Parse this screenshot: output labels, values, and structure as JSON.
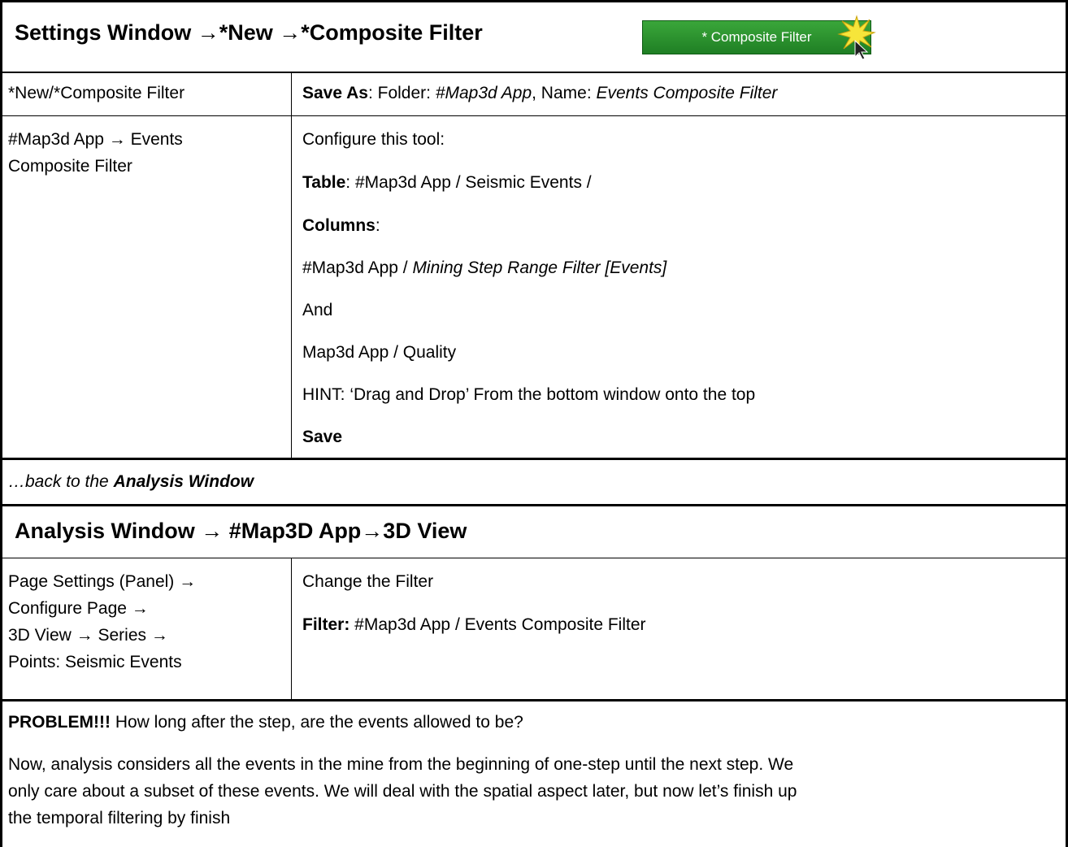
{
  "section1": {
    "title": "Settings Window →*New →*Composite Filter",
    "badge_label": "* Composite Filter",
    "rows": [
      {
        "left": "*New/*Composite Filter",
        "right": {
          "save_as_label": "Save As",
          "folder_label": ": Folder: ",
          "folder_value": "#Map3d App",
          "name_label": ", Name: ",
          "name_value": "Events Composite Filter"
        }
      },
      {
        "left_line1": "#Map3d App → Events",
        "left_line2": "Composite Filter",
        "configure": "Configure this tool:",
        "table_label": "Table",
        "table_value": ": #Map3d App / Seismic Events /",
        "columns_label": "Columns",
        "columns_suffix": ":",
        "col1_prefix": "#Map3d App / ",
        "col1_italic": "Mining Step Range Filter [Events]",
        "and": "And",
        "col2": "Map3d App / Quality",
        "hint": "HINT: ‘Drag and Drop’ From the bottom window onto the top",
        "save": "Save"
      }
    ]
  },
  "back_row": {
    "prefix": "…back to the ",
    "bold": "Analysis Window"
  },
  "section2": {
    "title": "Analysis Window → #Map3D App→3D View",
    "left_lines": [
      "Page Settings (Panel) →",
      "Configure Page →",
      "3D View → Series →",
      "Points: Seismic Events"
    ],
    "change": "Change the Filter",
    "filter_label": "Filter:",
    "filter_value": " #Map3d App / Events Composite Filter"
  },
  "problem": {
    "label": "PROBLEM!!!",
    "question": " How long after the step, are the events allowed to be?",
    "para_line1": "Now, analysis considers all the events in the mine from the beginning of one-step until the next step. We",
    "para_line2": "only care about a subset of these events. We will deal with the spatial aspect later, but now let’s finish up",
    "para_line3": "the temporal filtering by finish"
  },
  "colors": {
    "badge_bg": "#2e9a33",
    "starburst": "#f6e53a"
  }
}
